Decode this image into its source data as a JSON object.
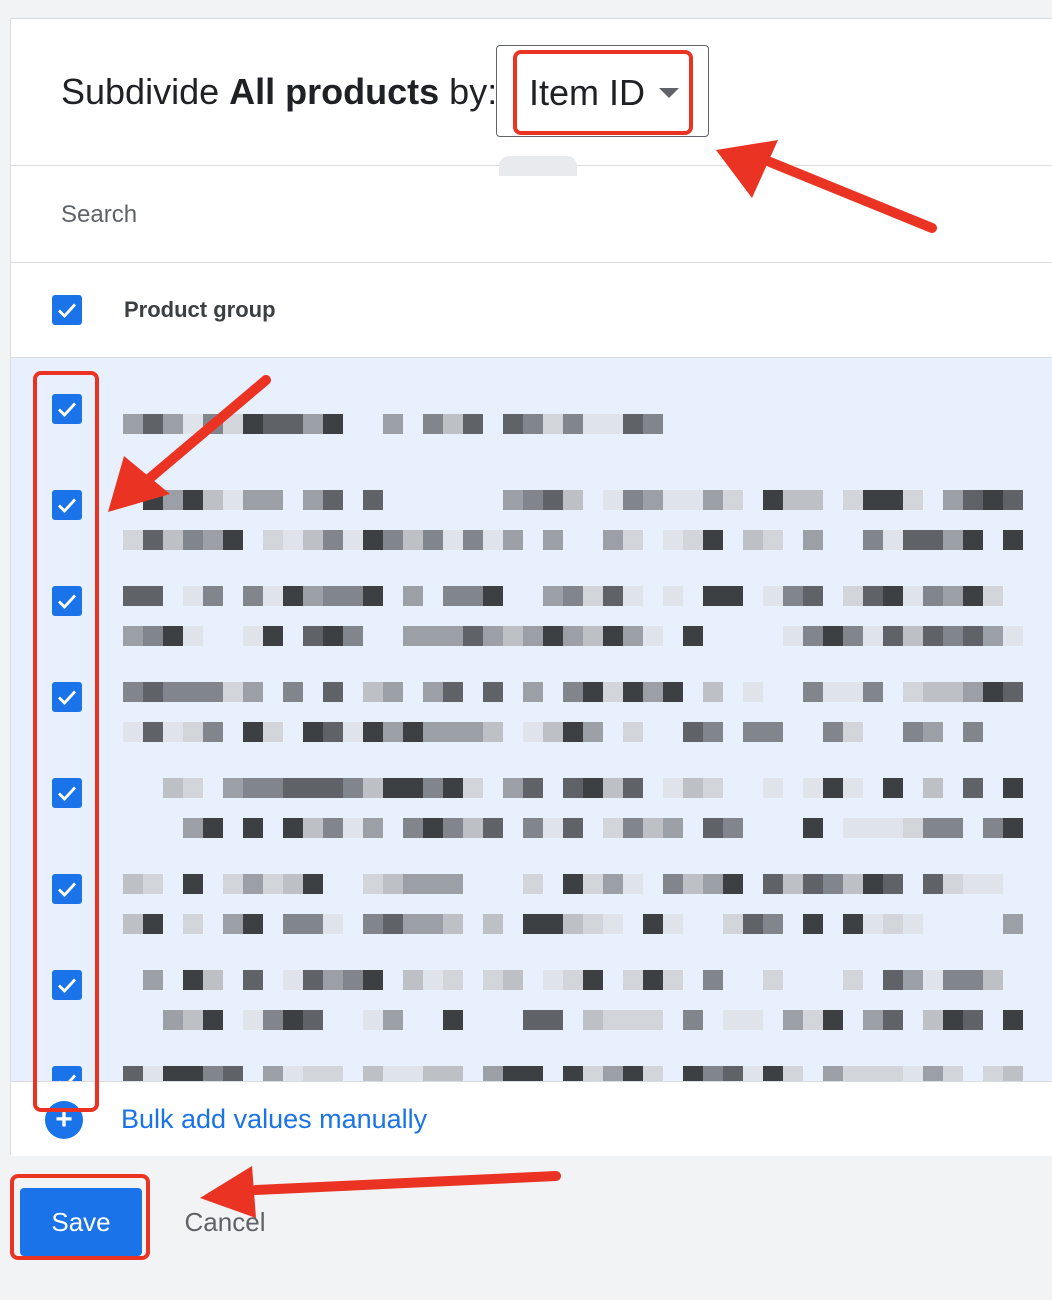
{
  "header": {
    "title_prefix": "Subdivide",
    "title_bold": "All products",
    "title_suffix": "by:",
    "dimension_value": "Item ID"
  },
  "search": {
    "placeholder": "Search"
  },
  "table": {
    "column_header": "Product group",
    "select_all_checked": true
  },
  "rows": [
    {
      "checked": true
    },
    {
      "checked": true
    },
    {
      "checked": true
    },
    {
      "checked": true
    },
    {
      "checked": true
    },
    {
      "checked": true
    },
    {
      "checked": true
    },
    {
      "checked": true
    }
  ],
  "footer": {
    "bulk_add_label": "Bulk add values manually"
  },
  "actions": {
    "save_label": "Save",
    "cancel_label": "Cancel"
  },
  "colors": {
    "accent": "#1a73e8",
    "selected_row_bg": "#e8f0fe",
    "annotation": "#ea3323"
  }
}
